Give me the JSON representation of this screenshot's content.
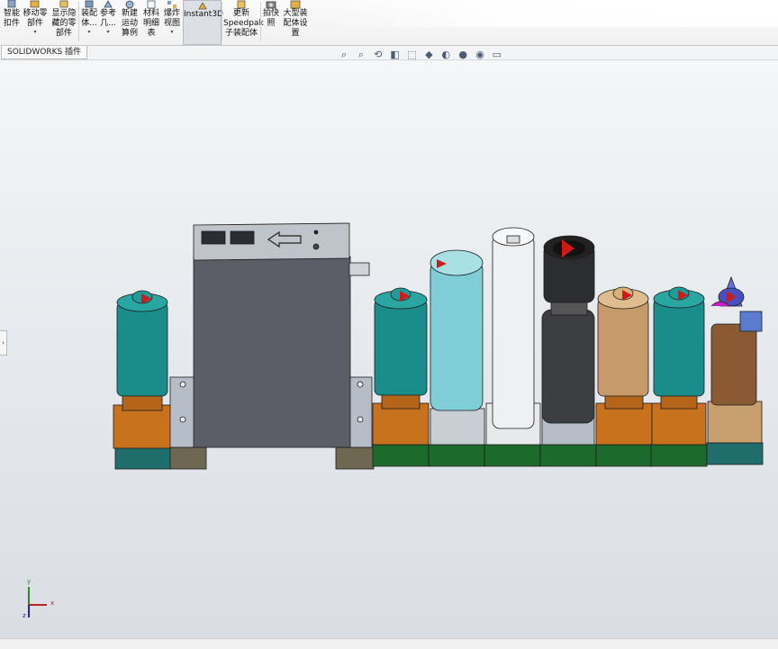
{
  "ribbon": {
    "buttons": [
      {
        "line1": "智能",
        "line2": "扣件",
        "line3": ""
      },
      {
        "line1": "移动零",
        "line2": "部件",
        "line3": ""
      },
      {
        "line1": "显示隐",
        "line2": "藏的零",
        "line3": "部件"
      },
      {
        "line1": "装配",
        "line2": "体...",
        "line3": ""
      },
      {
        "line1": "参考",
        "line2": "几...",
        "line3": ""
      },
      {
        "line1": "新建",
        "line2": "运动",
        "line3": "算例"
      },
      {
        "line1": "材料",
        "line2": "明细",
        "line3": "表"
      },
      {
        "line1": "爆炸",
        "line2": "视图",
        "line3": ""
      },
      {
        "line1": "Instant3D",
        "line2": "",
        "line3": ""
      },
      {
        "line1": "更新",
        "line2": "Speedpak",
        "line3": "子装配体"
      },
      {
        "line1": "拍快",
        "line2": "照",
        "line3": ""
      },
      {
        "line1": "大型装",
        "line2": "配体设",
        "line3": "置"
      }
    ]
  },
  "tabs": {
    "addins": "SOLIDWORKS 插件"
  },
  "hud": {
    "icons": [
      "zoom-fit-icon",
      "zoom-area-icon",
      "previous-view-icon",
      "section-view-icon",
      "view-orientation-icon",
      "display-style-icon",
      "hide-show-icon",
      "appearance-icon",
      "scene-icon",
      "display-settings-icon"
    ]
  },
  "triad": {
    "x": "x",
    "y": "y",
    "z": "z"
  },
  "colors": {
    "teal": "#1a8c8a",
    "orange": "#c8721e",
    "green": "#1c6b2c",
    "gray_body": "#5b5e66",
    "light_blue": "#7fcdd6",
    "tan": "#c69a6a",
    "brown": "#8a5a35",
    "red": "#d01a1a"
  }
}
